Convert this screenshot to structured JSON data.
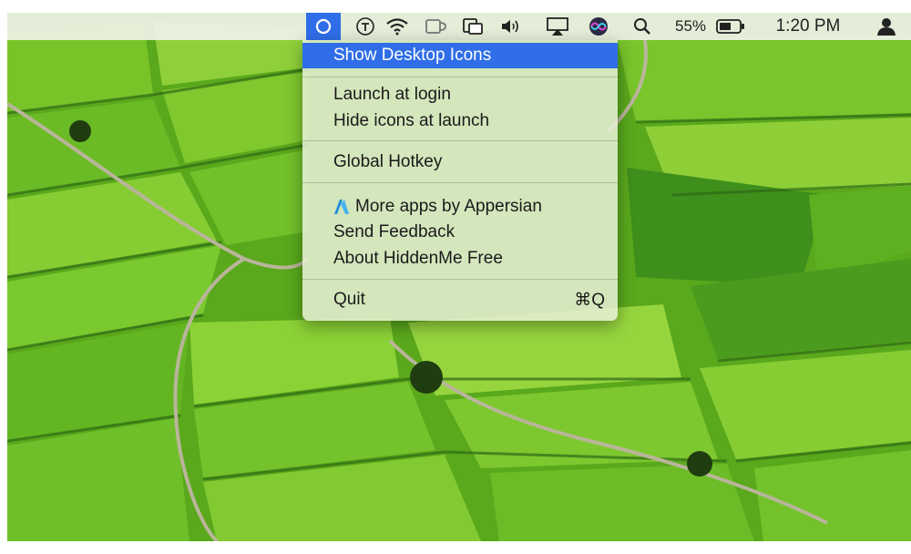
{
  "menubar": {
    "icons": [
      "hiddenme-icon",
      "typeeto-icon",
      "wifi-icon",
      "coffee-icon",
      "screen-share-icon",
      "volume-icon",
      "airplay-icon",
      "siri-icon",
      "search-icon",
      "battery-icon",
      "user-icon"
    ],
    "battery_percent": "55%",
    "clock": "1:20 PM"
  },
  "menu": {
    "show_desktop_icons": "Show Desktop Icons",
    "launch_at_login": "Launch at login",
    "hide_icons_at_launch": "Hide icons at launch",
    "global_hotkey": "Global Hotkey",
    "more_apps": "More apps by Appersian",
    "send_feedback": "Send Feedback",
    "about": "About HiddenMe Free",
    "quit": "Quit",
    "quit_shortcut": "⌘Q"
  },
  "colors": {
    "highlight": "#2f6ee8",
    "appersian_logo": "#1f8fd8",
    "field_green": "#5fb21e"
  }
}
